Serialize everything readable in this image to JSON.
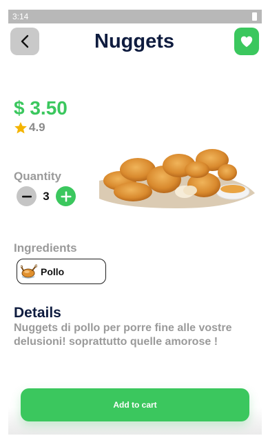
{
  "status_bar": {
    "time": "3:14"
  },
  "header": {
    "title": "Nuggets"
  },
  "product": {
    "price": "$ 3.50",
    "rating": "4.9",
    "quantity_label": "Quantity",
    "quantity": "3",
    "ingredients_label": "Ingredients",
    "ingredients": [
      {
        "label": "Pollo",
        "icon": "roast-chicken-icon"
      }
    ],
    "details_title": "Details",
    "details_text": "Nuggets di pollo per porre fine alle vostre delusioni! soprattutto quelle amorose !"
  },
  "actions": {
    "add_to_cart": "Add to cart"
  },
  "colors": {
    "accent": "#3bc75e",
    "title": "#0f1c3f",
    "muted": "#9a9a9a",
    "back_button": "#c9c9c9"
  }
}
